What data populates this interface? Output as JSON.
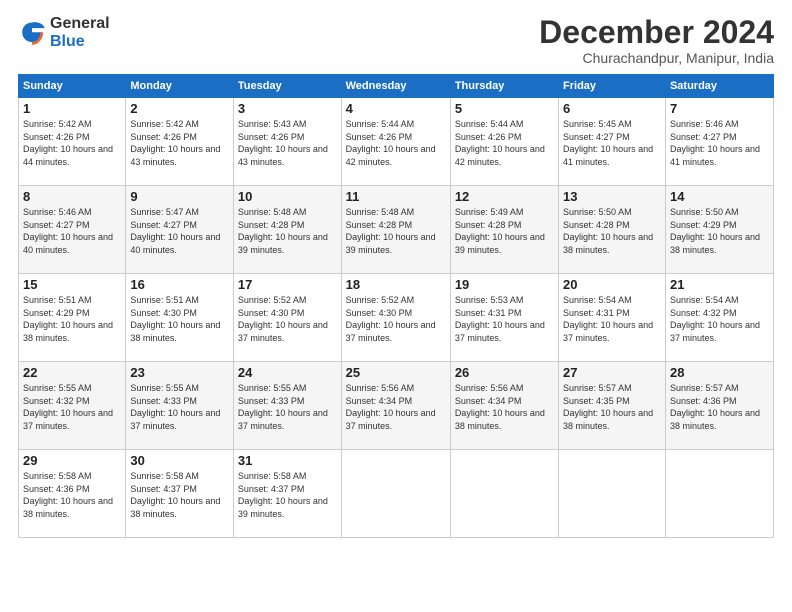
{
  "logo": {
    "general": "General",
    "blue": "Blue"
  },
  "title": "December 2024",
  "subtitle": "Churachandpur, Manipur, India",
  "days_of_week": [
    "Sunday",
    "Monday",
    "Tuesday",
    "Wednesday",
    "Thursday",
    "Friday",
    "Saturday"
  ],
  "weeks": [
    [
      {
        "day": "1",
        "sunrise": "5:42 AM",
        "sunset": "4:26 PM",
        "daylight": "10 hours and 44 minutes."
      },
      {
        "day": "2",
        "sunrise": "5:42 AM",
        "sunset": "4:26 PM",
        "daylight": "10 hours and 43 minutes."
      },
      {
        "day": "3",
        "sunrise": "5:43 AM",
        "sunset": "4:26 PM",
        "daylight": "10 hours and 43 minutes."
      },
      {
        "day": "4",
        "sunrise": "5:44 AM",
        "sunset": "4:26 PM",
        "daylight": "10 hours and 42 minutes."
      },
      {
        "day": "5",
        "sunrise": "5:44 AM",
        "sunset": "4:26 PM",
        "daylight": "10 hours and 42 minutes."
      },
      {
        "day": "6",
        "sunrise": "5:45 AM",
        "sunset": "4:27 PM",
        "daylight": "10 hours and 41 minutes."
      },
      {
        "day": "7",
        "sunrise": "5:46 AM",
        "sunset": "4:27 PM",
        "daylight": "10 hours and 41 minutes."
      }
    ],
    [
      {
        "day": "8",
        "sunrise": "5:46 AM",
        "sunset": "4:27 PM",
        "daylight": "10 hours and 40 minutes."
      },
      {
        "day": "9",
        "sunrise": "5:47 AM",
        "sunset": "4:27 PM",
        "daylight": "10 hours and 40 minutes."
      },
      {
        "day": "10",
        "sunrise": "5:48 AM",
        "sunset": "4:28 PM",
        "daylight": "10 hours and 39 minutes."
      },
      {
        "day": "11",
        "sunrise": "5:48 AM",
        "sunset": "4:28 PM",
        "daylight": "10 hours and 39 minutes."
      },
      {
        "day": "12",
        "sunrise": "5:49 AM",
        "sunset": "4:28 PM",
        "daylight": "10 hours and 39 minutes."
      },
      {
        "day": "13",
        "sunrise": "5:50 AM",
        "sunset": "4:28 PM",
        "daylight": "10 hours and 38 minutes."
      },
      {
        "day": "14",
        "sunrise": "5:50 AM",
        "sunset": "4:29 PM",
        "daylight": "10 hours and 38 minutes."
      }
    ],
    [
      {
        "day": "15",
        "sunrise": "5:51 AM",
        "sunset": "4:29 PM",
        "daylight": "10 hours and 38 minutes."
      },
      {
        "day": "16",
        "sunrise": "5:51 AM",
        "sunset": "4:30 PM",
        "daylight": "10 hours and 38 minutes."
      },
      {
        "day": "17",
        "sunrise": "5:52 AM",
        "sunset": "4:30 PM",
        "daylight": "10 hours and 37 minutes."
      },
      {
        "day": "18",
        "sunrise": "5:52 AM",
        "sunset": "4:30 PM",
        "daylight": "10 hours and 37 minutes."
      },
      {
        "day": "19",
        "sunrise": "5:53 AM",
        "sunset": "4:31 PM",
        "daylight": "10 hours and 37 minutes."
      },
      {
        "day": "20",
        "sunrise": "5:54 AM",
        "sunset": "4:31 PM",
        "daylight": "10 hours and 37 minutes."
      },
      {
        "day": "21",
        "sunrise": "5:54 AM",
        "sunset": "4:32 PM",
        "daylight": "10 hours and 37 minutes."
      }
    ],
    [
      {
        "day": "22",
        "sunrise": "5:55 AM",
        "sunset": "4:32 PM",
        "daylight": "10 hours and 37 minutes."
      },
      {
        "day": "23",
        "sunrise": "5:55 AM",
        "sunset": "4:33 PM",
        "daylight": "10 hours and 37 minutes."
      },
      {
        "day": "24",
        "sunrise": "5:55 AM",
        "sunset": "4:33 PM",
        "daylight": "10 hours and 37 minutes."
      },
      {
        "day": "25",
        "sunrise": "5:56 AM",
        "sunset": "4:34 PM",
        "daylight": "10 hours and 37 minutes."
      },
      {
        "day": "26",
        "sunrise": "5:56 AM",
        "sunset": "4:34 PM",
        "daylight": "10 hours and 38 minutes."
      },
      {
        "day": "27",
        "sunrise": "5:57 AM",
        "sunset": "4:35 PM",
        "daylight": "10 hours and 38 minutes."
      },
      {
        "day": "28",
        "sunrise": "5:57 AM",
        "sunset": "4:36 PM",
        "daylight": "10 hours and 38 minutes."
      }
    ],
    [
      {
        "day": "29",
        "sunrise": "5:58 AM",
        "sunset": "4:36 PM",
        "daylight": "10 hours and 38 minutes."
      },
      {
        "day": "30",
        "sunrise": "5:58 AM",
        "sunset": "4:37 PM",
        "daylight": "10 hours and 38 minutes."
      },
      {
        "day": "31",
        "sunrise": "5:58 AM",
        "sunset": "4:37 PM",
        "daylight": "10 hours and 39 minutes."
      },
      null,
      null,
      null,
      null
    ]
  ]
}
